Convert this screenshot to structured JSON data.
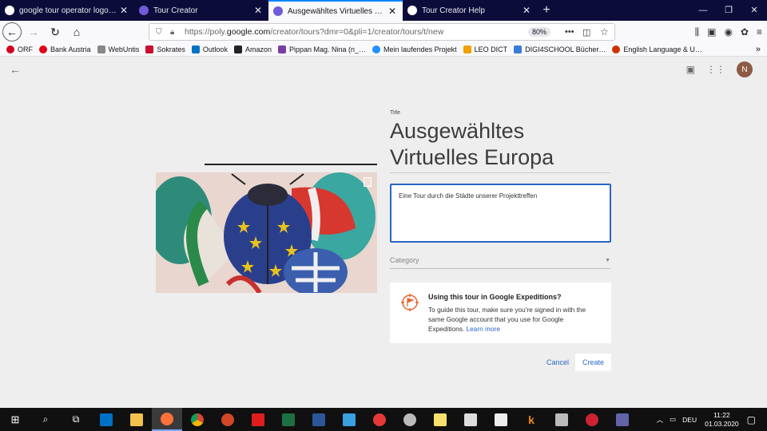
{
  "tabs": [
    {
      "label": "google tour operator logo – Goo",
      "icon": "google-icon",
      "color": "#ffffff"
    },
    {
      "label": "Tour Creator",
      "icon": "tour-creator-icon",
      "color": "#6f5bd8"
    },
    {
      "label": "Ausgewähltes Virtuelles Europa",
      "icon": "tour-creator-icon",
      "color": "#6f5bd8",
      "active": true
    },
    {
      "label": "Tour Creator Help",
      "icon": "google-icon",
      "color": "#ffffff"
    }
  ],
  "window_controls": {
    "minimize": "—",
    "restore": "❐",
    "close": "✕"
  },
  "nav": {
    "url_prefix": "https://poly.",
    "url_host": "google.com",
    "url_path": "/creator/tours?dmr=0&pli=1/creator/tours/t/new",
    "zoom": "80%"
  },
  "bookmarks": [
    {
      "label": "ORF",
      "color": "#d0021b"
    },
    {
      "label": "Bank Austria",
      "color": "#e2001a"
    },
    {
      "label": "WebUntis",
      "color": "#888888"
    },
    {
      "label": "Sokrates",
      "color": "#c8102e"
    },
    {
      "label": "Outlook",
      "color": "#0072c6"
    },
    {
      "label": "Amazon",
      "color": "#222222"
    },
    {
      "label": "Pippan Mag. Nina (n_…",
      "color": "#7a3ea0"
    },
    {
      "label": "Mein laufendes Projekt",
      "color": "#1e90ff"
    },
    {
      "label": "LEO DICT",
      "color": "#f0a000"
    },
    {
      "label": "DIGI4SCHOOL Bücher…",
      "color": "#3a7bd5"
    },
    {
      "label": "English Language & U…",
      "color": "#cc3300"
    }
  ],
  "page": {
    "title_label": "Title",
    "title": "Ausgewähltes Virtuelles Europa",
    "description": "Eine Tour durch die Städte unserer Projekttreffen",
    "category_placeholder": "Category",
    "avatar_letter": "N",
    "expeditions": {
      "heading": "Using this tour in Google Expeditions?",
      "body": "To guide this tour, make sure you're signed in with the same Google account that you use for Google Expeditions.",
      "link": "Learn more"
    },
    "cancel_label": "Cancel",
    "create_label": "Create"
  },
  "taskbar": {
    "apps": [
      {
        "name": "outlook",
        "color": "#0072c6"
      },
      {
        "name": "file-explorer",
        "color": "#f2c14e"
      },
      {
        "name": "firefox",
        "color": "#ff7139",
        "active": true
      },
      {
        "name": "chrome",
        "color": "#4caf50"
      },
      {
        "name": "powerpoint",
        "color": "#d24726"
      },
      {
        "name": "acrobat",
        "color": "#e01e1e"
      },
      {
        "name": "excel",
        "color": "#1d7044"
      },
      {
        "name": "word",
        "color": "#2b579a"
      },
      {
        "name": "media-player",
        "color": "#3aa0e0"
      },
      {
        "name": "red-app",
        "color": "#e53935"
      },
      {
        "name": "paint",
        "color": "#bbbbbb"
      },
      {
        "name": "sticky-notes",
        "color": "#f7e06b"
      },
      {
        "name": "calculator",
        "color": "#dddddd"
      },
      {
        "name": "ink",
        "color": "#eeeeee"
      },
      {
        "name": "k-app",
        "color": "#f08a00"
      },
      {
        "name": "scanner",
        "color": "#bbbbbb"
      },
      {
        "name": "sync-app",
        "color": "#cc2233"
      },
      {
        "name": "teams",
        "color": "#6264a7"
      }
    ],
    "language": "DEU",
    "time": "11:22",
    "date": "01.03.2020"
  }
}
